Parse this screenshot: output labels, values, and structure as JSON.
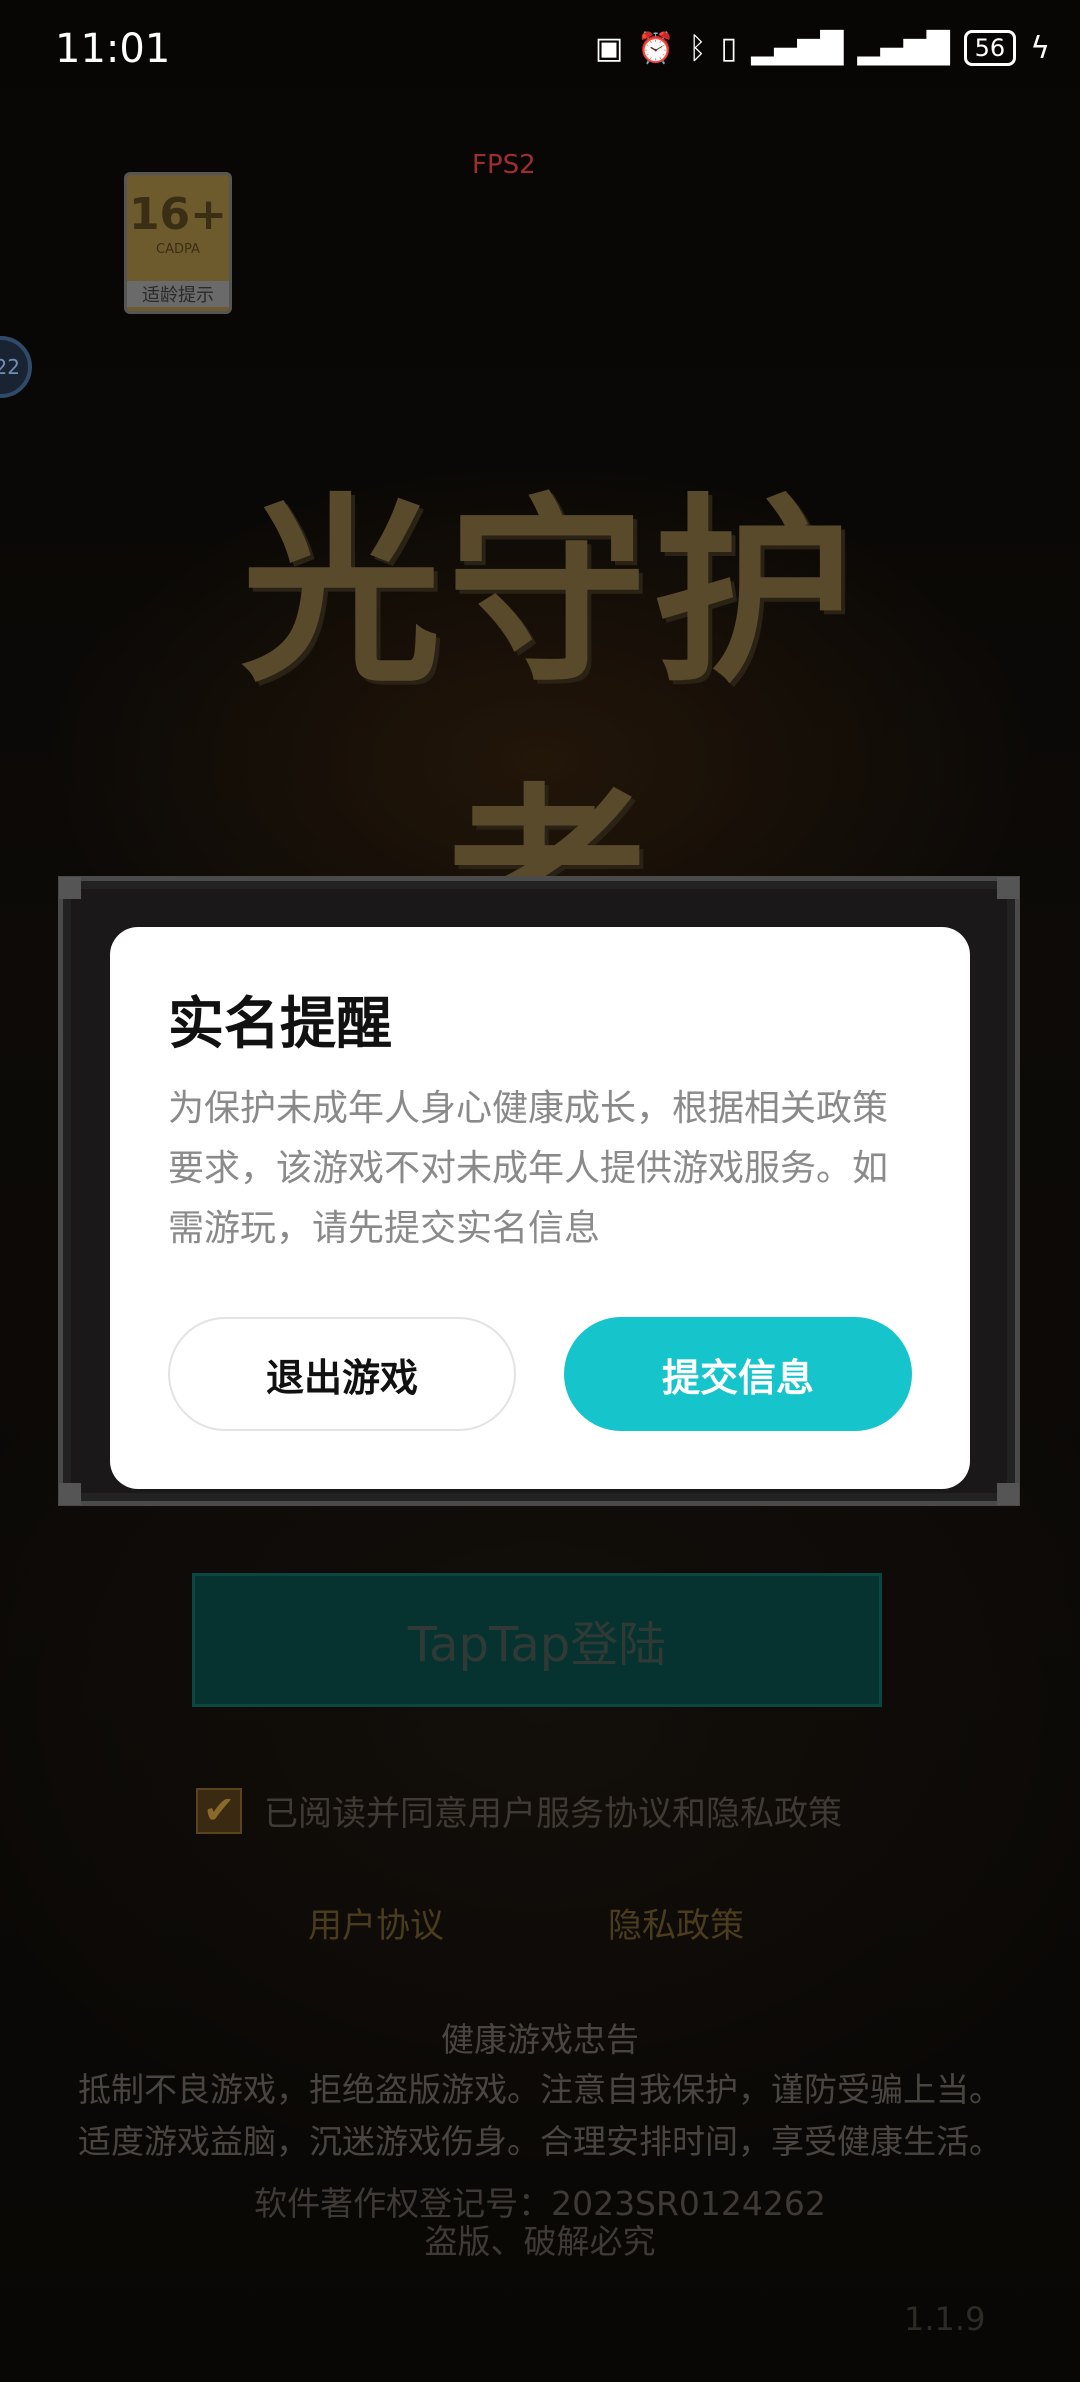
{
  "status_bar": {
    "time": "11:01",
    "icons": [
      "nfc-icon",
      "alarm-icon",
      "bluetooth-icon",
      "vibrate-icon",
      "signal-4g-icon",
      "signal-4g-icon"
    ],
    "battery": "56"
  },
  "debug": {
    "fps": "FPS2"
  },
  "rating_badge": {
    "age": "16+",
    "org": "CADPA",
    "label": "适龄提示"
  },
  "floating_ball": {
    "text": "22"
  },
  "game": {
    "title": "光守护者"
  },
  "dialog": {
    "title": "实名提醒",
    "body": "为保护未成年人身心健康成长，根据相关政策要求，该游戏不对未成年人提供游戏服务。如需游玩，请先提交实名信息",
    "exit_label": "退出游戏",
    "submit_label": "提交信息",
    "accent_color": "#16c5cc"
  },
  "login": {
    "taptap_label": "TapTap登陆",
    "agree_text": "已阅读并同意用户服务协议和隐私政策",
    "agree_checked": true,
    "user_agreement": "用户协议",
    "privacy_policy": "隐私政策"
  },
  "health_notice": {
    "title": "健康游戏忠告",
    "line1": "抵制不良游戏，拒绝盗版游戏。注意自我保护，谨防受骗上当。",
    "line2": "适度游戏益脑，沉迷游戏伤身。合理安排时间，享受健康生活。",
    "copyright": "软件著作权登记号：2023SR0124262",
    "piracy": "盗版、破解必究"
  },
  "version": "1.1.9"
}
